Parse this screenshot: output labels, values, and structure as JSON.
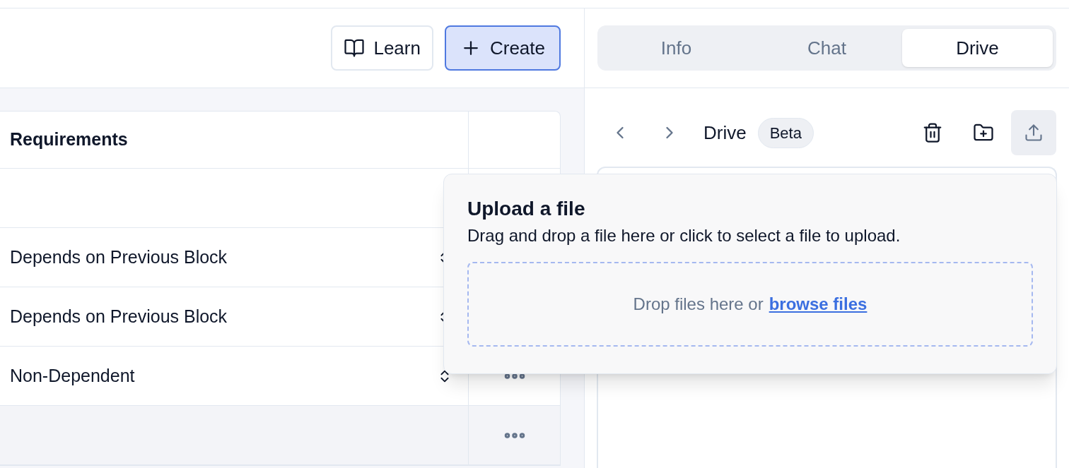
{
  "header": {
    "buttons": [
      {
        "label": "Learn",
        "kind": "learn",
        "primary": false
      },
      {
        "label": "Create",
        "kind": "create",
        "primary": true
      }
    ]
  },
  "table": {
    "columns": [
      "Requirements"
    ],
    "rows": [
      {
        "requirement": "",
        "highlighted": false
      },
      {
        "requirement": "Depends on Previous Block",
        "highlighted": false
      },
      {
        "requirement": "Depends on Previous Block",
        "highlighted": false
      },
      {
        "requirement": "Non-Dependent",
        "highlighted": false,
        "menu": true
      },
      {
        "requirement": "",
        "highlighted": true,
        "menu": true
      }
    ]
  },
  "tabs": [
    {
      "label": "Info",
      "selected": false
    },
    {
      "label": "Chat",
      "selected": false
    },
    {
      "label": "Drive",
      "selected": true
    }
  ],
  "drive": {
    "title": "Drive",
    "badge": "Beta",
    "upload_active": true
  },
  "upload_popup": {
    "title": "Upload a file",
    "description": "Drag and drop a file here or click to select a file to upload.",
    "drop_text": "Drop files here or",
    "link": "browse files"
  }
}
